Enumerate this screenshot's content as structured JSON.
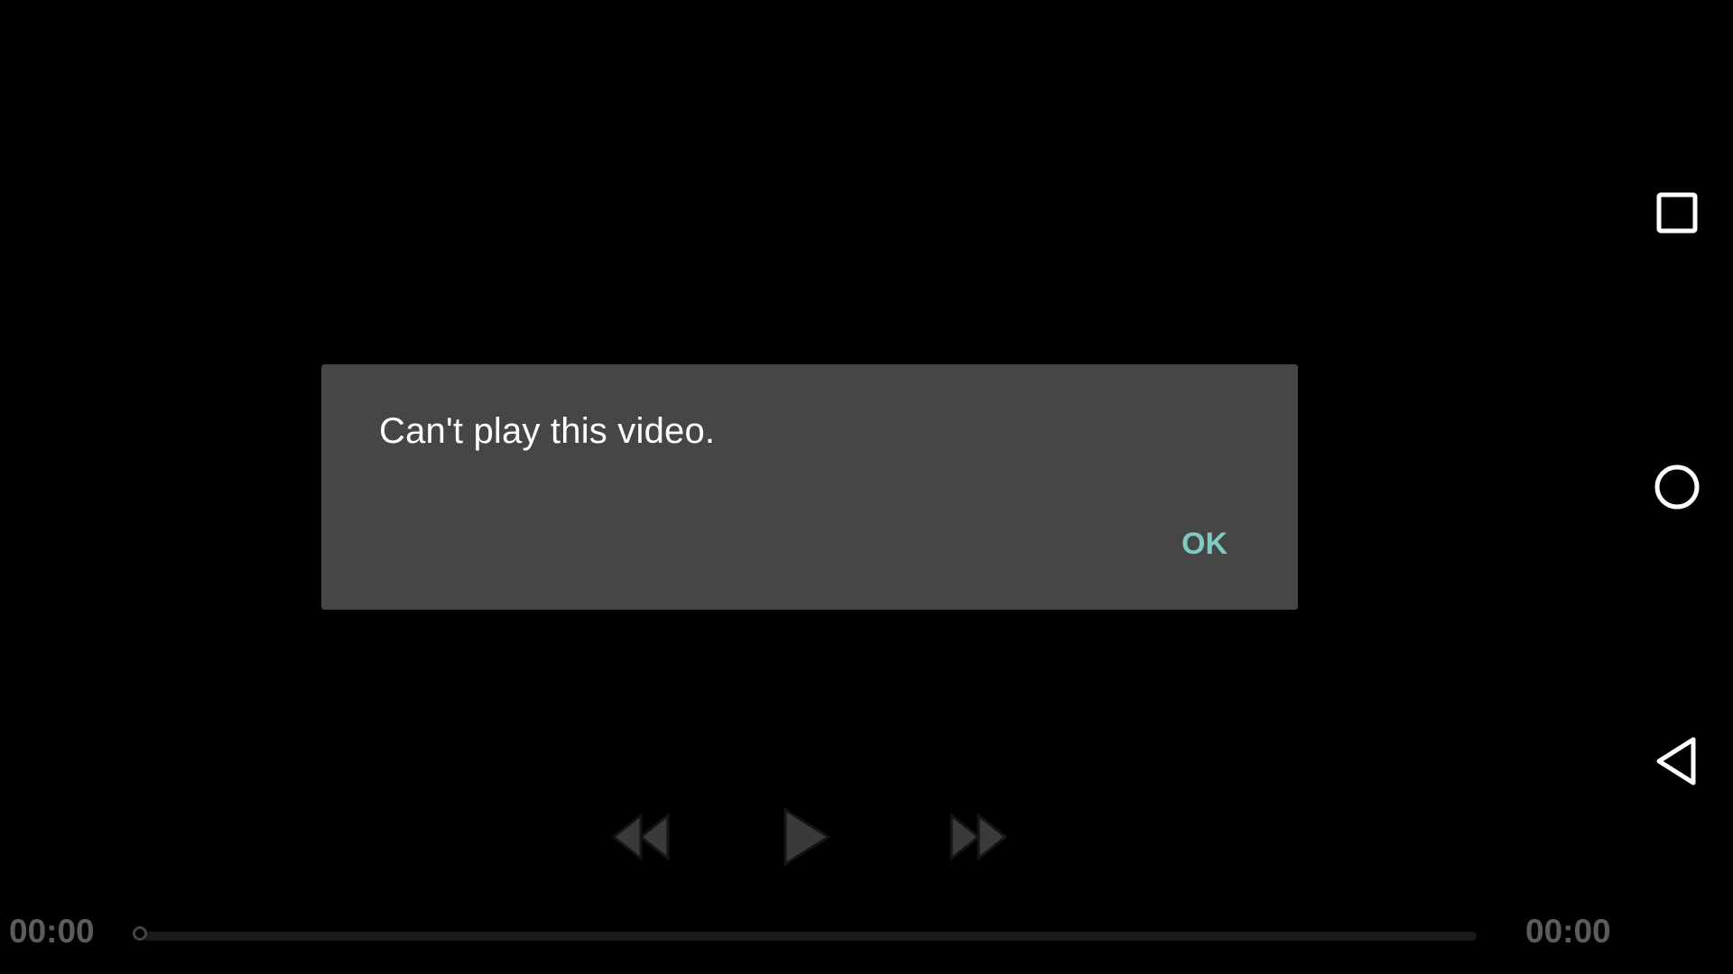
{
  "dialog": {
    "message": "Can't play this video.",
    "ok_label": "OK"
  },
  "controls": {
    "rewind_icon": "rewind-icon",
    "play_icon": "play-icon",
    "forward_icon": "fast-forward-icon"
  },
  "seek": {
    "current_time": "00:00",
    "total_time": "00:00",
    "progress": 0
  },
  "nav_bar": {
    "recents_icon": "square-icon",
    "home_icon": "circle-icon",
    "back_icon": "triangle-back-icon"
  },
  "colors": {
    "background": "#000000",
    "dialog_background": "#464646",
    "accent": "#7fcbc4",
    "dialog_text": "#ffffff",
    "time_text": "#5c5c5c"
  }
}
